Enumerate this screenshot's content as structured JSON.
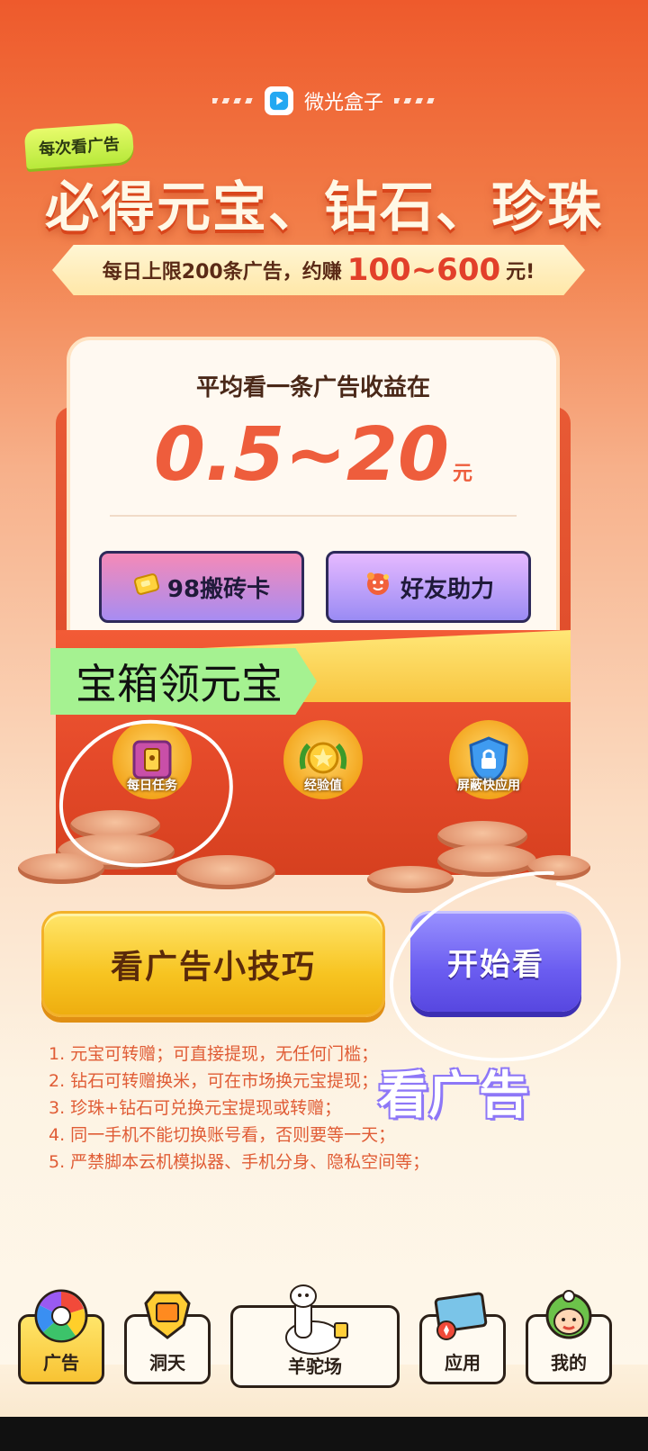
{
  "brand": {
    "name": "微光盒子"
  },
  "badge": {
    "text": "每次看广告"
  },
  "headline": {
    "text": "必得元宝、钻石、珍珠"
  },
  "ribbon": {
    "prefix": "每日上限200条广告，约赚",
    "amount": "100~600",
    "suffix": "元!"
  },
  "card": {
    "title": "平均看一条广告收益在",
    "amount": "0.5~20",
    "unit": "元",
    "buttons": [
      {
        "label": "98搬砖卡",
        "icon": "gold-card-icon"
      },
      {
        "label": "好友助力",
        "icon": "friend-helper-icon"
      }
    ]
  },
  "annotation_tag": {
    "text": "宝箱领元宝"
  },
  "icon_items": [
    {
      "label": "每日任务",
      "icon": "treasure-chest-icon"
    },
    {
      "label": "经验值",
      "icon": "star-badge-icon"
    },
    {
      "label": "屏蔽快应用",
      "icon": "shield-lock-icon"
    }
  ],
  "actions": {
    "tips_label": "看广告小技巧",
    "start_label": "开始看"
  },
  "annotation_watch": {
    "text": "看广告"
  },
  "rules": [
    "1. 元宝可转赠；可直接提现，无任何门槛；",
    "2. 钻石可转赠换米，可在市场换元宝提现；",
    "3. 珍珠+钻石可兑换元宝提现或转赠；",
    "4. 同一手机不能切换账号看，否则要等一天；",
    "5. 严禁脚本云机模拟器、手机分身、隐私空间等；"
  ],
  "nav": {
    "tabs": [
      {
        "label": "广告",
        "icon": "color-wheel-icon",
        "active": true
      },
      {
        "label": "洞天",
        "icon": "gold-crest-icon",
        "active": false
      },
      {
        "label": "羊驼场",
        "icon": "alpaca-icon",
        "active": false
      },
      {
        "label": "应用",
        "icon": "map-compass-icon",
        "active": false
      },
      {
        "label": "我的",
        "icon": "avatar-icon",
        "active": false
      }
    ]
  },
  "colors": {
    "accent": "#ee5d3c",
    "start_button": "#6a5cf0",
    "tips_button": "#f7c421",
    "annotation_green": "#a5f291"
  }
}
